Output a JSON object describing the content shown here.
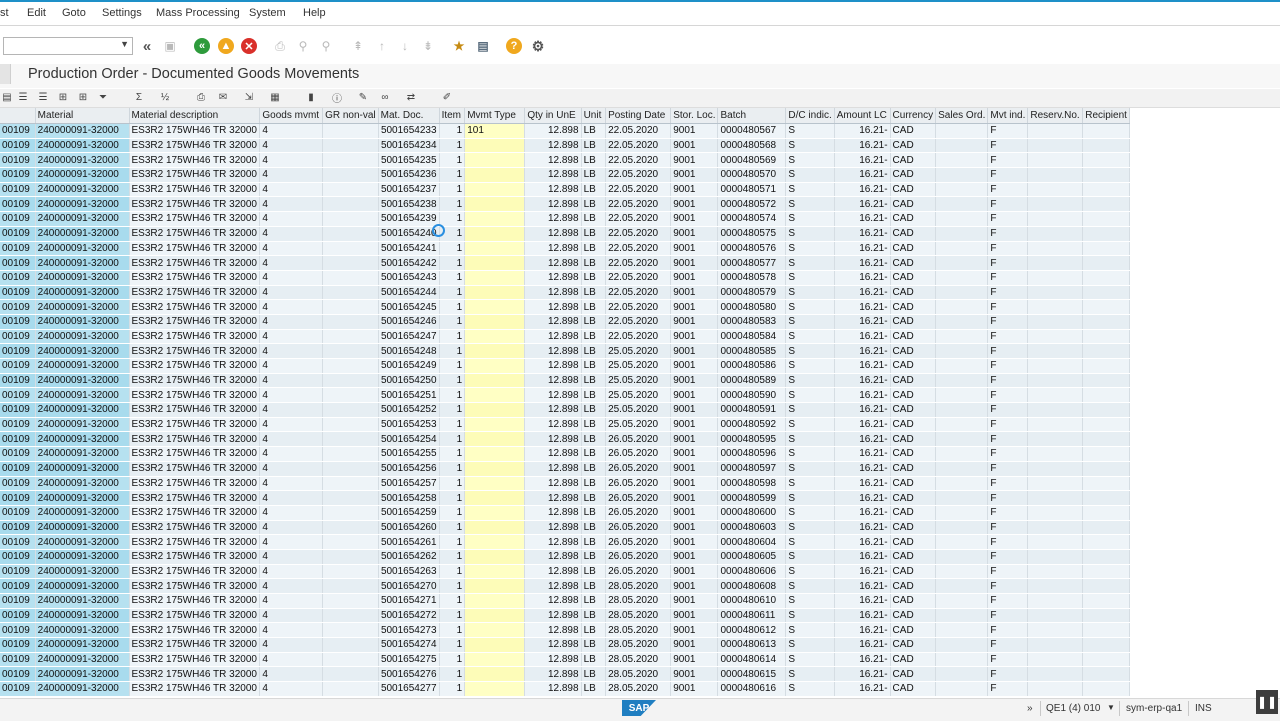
{
  "menu": [
    "st",
    "Edit",
    "Goto",
    "Settings",
    "Mass Processing",
    "System",
    "Help"
  ],
  "title": "Production Order - Documented Goods Movements",
  "toolbar_icons": [
    "back-icon",
    "exit-icon",
    "cancel-icon",
    "help-icon",
    "settings-icon"
  ],
  "columns": [
    "Material",
    "Material description",
    "Goods mvmt",
    "GR non-val",
    "Mat. Doc.",
    "Item",
    "Mvmt Type",
    "Qty in UnE",
    "Unit",
    "Posting Date",
    "Stor. Loc.",
    "Batch",
    "D/C indic.",
    "Amount LC",
    "Currency",
    "Sales Ord.",
    "Mvt ind.",
    "Reserv.No.",
    "Recipient"
  ],
  "rows": [
    [
      "00109",
      "240000091-32000",
      "ES3R2 175WH46 TR 32000",
      "4",
      "",
      "5001654233",
      "1",
      "101",
      "12.898",
      "LB",
      "22.05.2020",
      "9001",
      "0000480567",
      "S",
      "16.21-",
      "CAD",
      "",
      "F",
      "",
      ""
    ],
    [
      "00109",
      "240000091-32000",
      "ES3R2 175WH46 TR 32000",
      "4",
      "",
      "5001654234",
      "1",
      "",
      "12.898",
      "LB",
      "22.05.2020",
      "9001",
      "0000480568",
      "S",
      "16.21-",
      "CAD",
      "",
      "F",
      "",
      ""
    ],
    [
      "00109",
      "240000091-32000",
      "ES3R2 175WH46 TR 32000",
      "4",
      "",
      "5001654235",
      "1",
      "",
      "12.898",
      "LB",
      "22.05.2020",
      "9001",
      "0000480569",
      "S",
      "16.21-",
      "CAD",
      "",
      "F",
      "",
      ""
    ],
    [
      "00109",
      "240000091-32000",
      "ES3R2 175WH46 TR 32000",
      "4",
      "",
      "5001654236",
      "1",
      "",
      "12.898",
      "LB",
      "22.05.2020",
      "9001",
      "0000480570",
      "S",
      "16.21-",
      "CAD",
      "",
      "F",
      "",
      ""
    ],
    [
      "00109",
      "240000091-32000",
      "ES3R2 175WH46 TR 32000",
      "4",
      "",
      "5001654237",
      "1",
      "",
      "12.898",
      "LB",
      "22.05.2020",
      "9001",
      "0000480571",
      "S",
      "16.21-",
      "CAD",
      "",
      "F",
      "",
      ""
    ],
    [
      "00109",
      "240000091-32000",
      "ES3R2 175WH46 TR 32000",
      "4",
      "",
      "5001654238",
      "1",
      "",
      "12.898",
      "LB",
      "22.05.2020",
      "9001",
      "0000480572",
      "S",
      "16.21-",
      "CAD",
      "",
      "F",
      "",
      ""
    ],
    [
      "00109",
      "240000091-32000",
      "ES3R2 175WH46 TR 32000",
      "4",
      "",
      "5001654239",
      "1",
      "",
      "12.898",
      "LB",
      "22.05.2020",
      "9001",
      "0000480574",
      "S",
      "16.21-",
      "CAD",
      "",
      "F",
      "",
      ""
    ],
    [
      "00109",
      "240000091-32000",
      "ES3R2 175WH46 TR 32000",
      "4",
      "",
      "5001654240",
      "1",
      "",
      "12.898",
      "LB",
      "22.05.2020",
      "9001",
      "0000480575",
      "S",
      "16.21-",
      "CAD",
      "",
      "F",
      "",
      ""
    ],
    [
      "00109",
      "240000091-32000",
      "ES3R2 175WH46 TR 32000",
      "4",
      "",
      "5001654241",
      "1",
      "",
      "12.898",
      "LB",
      "22.05.2020",
      "9001",
      "0000480576",
      "S",
      "16.21-",
      "CAD",
      "",
      "F",
      "",
      ""
    ],
    [
      "00109",
      "240000091-32000",
      "ES3R2 175WH46 TR 32000",
      "4",
      "",
      "5001654242",
      "1",
      "",
      "12.898",
      "LB",
      "22.05.2020",
      "9001",
      "0000480577",
      "S",
      "16.21-",
      "CAD",
      "",
      "F",
      "",
      ""
    ],
    [
      "00109",
      "240000091-32000",
      "ES3R2 175WH46 TR 32000",
      "4",
      "",
      "5001654243",
      "1",
      "",
      "12.898",
      "LB",
      "22.05.2020",
      "9001",
      "0000480578",
      "S",
      "16.21-",
      "CAD",
      "",
      "F",
      "",
      ""
    ],
    [
      "00109",
      "240000091-32000",
      "ES3R2 175WH46 TR 32000",
      "4",
      "",
      "5001654244",
      "1",
      "",
      "12.898",
      "LB",
      "22.05.2020",
      "9001",
      "0000480579",
      "S",
      "16.21-",
      "CAD",
      "",
      "F",
      "",
      ""
    ],
    [
      "00109",
      "240000091-32000",
      "ES3R2 175WH46 TR 32000",
      "4",
      "",
      "5001654245",
      "1",
      "",
      "12.898",
      "LB",
      "22.05.2020",
      "9001",
      "0000480580",
      "S",
      "16.21-",
      "CAD",
      "",
      "F",
      "",
      ""
    ],
    [
      "00109",
      "240000091-32000",
      "ES3R2 175WH46 TR 32000",
      "4",
      "",
      "5001654246",
      "1",
      "",
      "12.898",
      "LB",
      "22.05.2020",
      "9001",
      "0000480583",
      "S",
      "16.21-",
      "CAD",
      "",
      "F",
      "",
      ""
    ],
    [
      "00109",
      "240000091-32000",
      "ES3R2 175WH46 TR 32000",
      "4",
      "",
      "5001654247",
      "1",
      "",
      "12.898",
      "LB",
      "22.05.2020",
      "9001",
      "0000480584",
      "S",
      "16.21-",
      "CAD",
      "",
      "F",
      "",
      ""
    ],
    [
      "00109",
      "240000091-32000",
      "ES3R2 175WH46 TR 32000",
      "4",
      "",
      "5001654248",
      "1",
      "",
      "12.898",
      "LB",
      "25.05.2020",
      "9001",
      "0000480585",
      "S",
      "16.21-",
      "CAD",
      "",
      "F",
      "",
      ""
    ],
    [
      "00109",
      "240000091-32000",
      "ES3R2 175WH46 TR 32000",
      "4",
      "",
      "5001654249",
      "1",
      "",
      "12.898",
      "LB",
      "25.05.2020",
      "9001",
      "0000480586",
      "S",
      "16.21-",
      "CAD",
      "",
      "F",
      "",
      ""
    ],
    [
      "00109",
      "240000091-32000",
      "ES3R2 175WH46 TR 32000",
      "4",
      "",
      "5001654250",
      "1",
      "",
      "12.898",
      "LB",
      "25.05.2020",
      "9001",
      "0000480589",
      "S",
      "16.21-",
      "CAD",
      "",
      "F",
      "",
      ""
    ],
    [
      "00109",
      "240000091-32000",
      "ES3R2 175WH46 TR 32000",
      "4",
      "",
      "5001654251",
      "1",
      "",
      "12.898",
      "LB",
      "25.05.2020",
      "9001",
      "0000480590",
      "S",
      "16.21-",
      "CAD",
      "",
      "F",
      "",
      ""
    ],
    [
      "00109",
      "240000091-32000",
      "ES3R2 175WH46 TR 32000",
      "4",
      "",
      "5001654252",
      "1",
      "",
      "12.898",
      "LB",
      "25.05.2020",
      "9001",
      "0000480591",
      "S",
      "16.21-",
      "CAD",
      "",
      "F",
      "",
      ""
    ],
    [
      "00109",
      "240000091-32000",
      "ES3R2 175WH46 TR 32000",
      "4",
      "",
      "5001654253",
      "1",
      "",
      "12.898",
      "LB",
      "25.05.2020",
      "9001",
      "0000480592",
      "S",
      "16.21-",
      "CAD",
      "",
      "F",
      "",
      ""
    ],
    [
      "00109",
      "240000091-32000",
      "ES3R2 175WH46 TR 32000",
      "4",
      "",
      "5001654254",
      "1",
      "",
      "12.898",
      "LB",
      "26.05.2020",
      "9001",
      "0000480595",
      "S",
      "16.21-",
      "CAD",
      "",
      "F",
      "",
      ""
    ],
    [
      "00109",
      "240000091-32000",
      "ES3R2 175WH46 TR 32000",
      "4",
      "",
      "5001654255",
      "1",
      "",
      "12.898",
      "LB",
      "26.05.2020",
      "9001",
      "0000480596",
      "S",
      "16.21-",
      "CAD",
      "",
      "F",
      "",
      ""
    ],
    [
      "00109",
      "240000091-32000",
      "ES3R2 175WH46 TR 32000",
      "4",
      "",
      "5001654256",
      "1",
      "",
      "12.898",
      "LB",
      "26.05.2020",
      "9001",
      "0000480597",
      "S",
      "16.21-",
      "CAD",
      "",
      "F",
      "",
      ""
    ],
    [
      "00109",
      "240000091-32000",
      "ES3R2 175WH46 TR 32000",
      "4",
      "",
      "5001654257",
      "1",
      "",
      "12.898",
      "LB",
      "26.05.2020",
      "9001",
      "0000480598",
      "S",
      "16.21-",
      "CAD",
      "",
      "F",
      "",
      ""
    ],
    [
      "00109",
      "240000091-32000",
      "ES3R2 175WH46 TR 32000",
      "4",
      "",
      "5001654258",
      "1",
      "",
      "12.898",
      "LB",
      "26.05.2020",
      "9001",
      "0000480599",
      "S",
      "16.21-",
      "CAD",
      "",
      "F",
      "",
      ""
    ],
    [
      "00109",
      "240000091-32000",
      "ES3R2 175WH46 TR 32000",
      "4",
      "",
      "5001654259",
      "1",
      "",
      "12.898",
      "LB",
      "26.05.2020",
      "9001",
      "0000480600",
      "S",
      "16.21-",
      "CAD",
      "",
      "F",
      "",
      ""
    ],
    [
      "00109",
      "240000091-32000",
      "ES3R2 175WH46 TR 32000",
      "4",
      "",
      "5001654260",
      "1",
      "",
      "12.898",
      "LB",
      "26.05.2020",
      "9001",
      "0000480603",
      "S",
      "16.21-",
      "CAD",
      "",
      "F",
      "",
      ""
    ],
    [
      "00109",
      "240000091-32000",
      "ES3R2 175WH46 TR 32000",
      "4",
      "",
      "5001654261",
      "1",
      "",
      "12.898",
      "LB",
      "26.05.2020",
      "9001",
      "0000480604",
      "S",
      "16.21-",
      "CAD",
      "",
      "F",
      "",
      ""
    ],
    [
      "00109",
      "240000091-32000",
      "ES3R2 175WH46 TR 32000",
      "4",
      "",
      "5001654262",
      "1",
      "",
      "12.898",
      "LB",
      "26.05.2020",
      "9001",
      "0000480605",
      "S",
      "16.21-",
      "CAD",
      "",
      "F",
      "",
      ""
    ],
    [
      "00109",
      "240000091-32000",
      "ES3R2 175WH46 TR 32000",
      "4",
      "",
      "5001654263",
      "1",
      "",
      "12.898",
      "LB",
      "26.05.2020",
      "9001",
      "0000480606",
      "S",
      "16.21-",
      "CAD",
      "",
      "F",
      "",
      ""
    ],
    [
      "00109",
      "240000091-32000",
      "ES3R2 175WH46 TR 32000",
      "4",
      "",
      "5001654270",
      "1",
      "",
      "12.898",
      "LB",
      "28.05.2020",
      "9001",
      "0000480608",
      "S",
      "16.21-",
      "CAD",
      "",
      "F",
      "",
      ""
    ],
    [
      "00109",
      "240000091-32000",
      "ES3R2 175WH46 TR 32000",
      "4",
      "",
      "5001654271",
      "1",
      "",
      "12.898",
      "LB",
      "28.05.2020",
      "9001",
      "0000480610",
      "S",
      "16.21-",
      "CAD",
      "",
      "F",
      "",
      ""
    ],
    [
      "00109",
      "240000091-32000",
      "ES3R2 175WH46 TR 32000",
      "4",
      "",
      "5001654272",
      "1",
      "",
      "12.898",
      "LB",
      "28.05.2020",
      "9001",
      "0000480611",
      "S",
      "16.21-",
      "CAD",
      "",
      "F",
      "",
      ""
    ],
    [
      "00109",
      "240000091-32000",
      "ES3R2 175WH46 TR 32000",
      "4",
      "",
      "5001654273",
      "1",
      "",
      "12.898",
      "LB",
      "28.05.2020",
      "9001",
      "0000480612",
      "S",
      "16.21-",
      "CAD",
      "",
      "F",
      "",
      ""
    ],
    [
      "00109",
      "240000091-32000",
      "ES3R2 175WH46 TR 32000",
      "4",
      "",
      "5001654274",
      "1",
      "",
      "12.898",
      "LB",
      "28.05.2020",
      "9001",
      "0000480613",
      "S",
      "16.21-",
      "CAD",
      "",
      "F",
      "",
      ""
    ],
    [
      "00109",
      "240000091-32000",
      "ES3R2 175WH46 TR 32000",
      "4",
      "",
      "5001654275",
      "1",
      "",
      "12.898",
      "LB",
      "28.05.2020",
      "9001",
      "0000480614",
      "S",
      "16.21-",
      "CAD",
      "",
      "F",
      "",
      ""
    ],
    [
      "00109",
      "240000091-32000",
      "ES3R2 175WH46 TR 32000",
      "4",
      "",
      "5001654276",
      "1",
      "",
      "12.898",
      "LB",
      "28.05.2020",
      "9001",
      "0000480615",
      "S",
      "16.21-",
      "CAD",
      "",
      "F",
      "",
      ""
    ],
    [
      "00109",
      "240000091-32000",
      "ES3R2 175WH46 TR 32000",
      "4",
      "",
      "5001654277",
      "1",
      "",
      "12.898",
      "LB",
      "28.05.2020",
      "9001",
      "0000480616",
      "S",
      "16.21-",
      "CAD",
      "",
      "F",
      "",
      ""
    ]
  ],
  "status": {
    "logo": "SAP",
    "system": "QE1 (4) 010",
    "server": "sym-erp-qa1",
    "mode": "INS"
  },
  "colors": {
    "key_column": "#b6e1f0",
    "highlight_column": "#ffffc4",
    "accent": "#1e90c8"
  }
}
